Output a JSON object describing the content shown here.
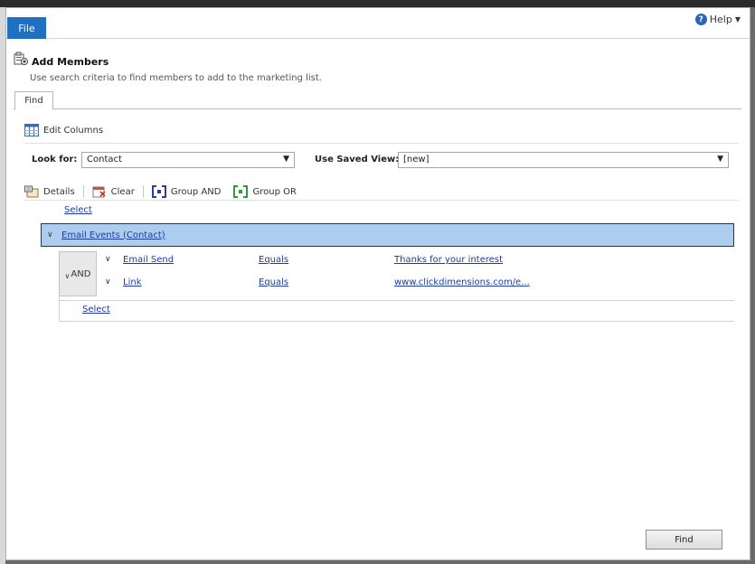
{
  "ribbon": {
    "file_label": "File",
    "help_label": "Help"
  },
  "header": {
    "title": "Add Members",
    "description": "Use search criteria to find members to add to the marketing list."
  },
  "tabs": [
    {
      "label": "Find"
    }
  ],
  "edit_columns_label": "Edit Columns",
  "look_for": {
    "label": "Look for:",
    "value": "Contact"
  },
  "saved_view": {
    "label": "Use Saved View:",
    "value": "[new]"
  },
  "toolbar": {
    "details": "Details",
    "clear": "Clear",
    "group_and": "Group AND",
    "group_or": "Group OR"
  },
  "query": {
    "select_top": "Select",
    "entity": "Email Events (Contact)",
    "group_label": "AND",
    "conditions": [
      {
        "field": "Email Send",
        "operator": "Equals",
        "value": "Thanks for your interest"
      },
      {
        "field": "Link",
        "operator": "Equals",
        "value": "www.clickdimensions.com/e..."
      }
    ],
    "select_bottom": "Select"
  },
  "find_button": "Find",
  "colors": {
    "file_tab": "#1f6fc2",
    "entity_row": "#acccf0",
    "link": "#1c3aa9"
  }
}
